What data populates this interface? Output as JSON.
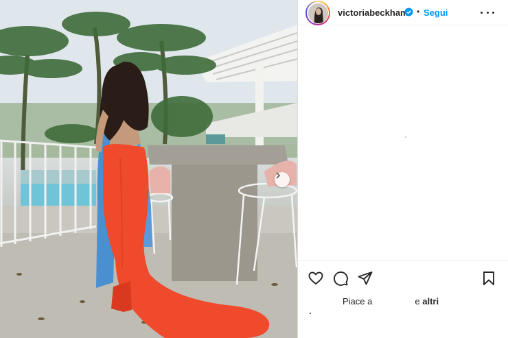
{
  "post": {
    "username": "victoriabeckham",
    "verified": true,
    "separator": "•",
    "follow_label": "Segui",
    "more_icon": "more-horizontal-icon"
  },
  "photo": {
    "next_icon": "chevron-right-icon"
  },
  "actions": {
    "icons": [
      "heart-icon",
      "comment-icon",
      "share-icon",
      "bookmark-icon"
    ]
  },
  "likes": {
    "prefix": "Piace a",
    "suffix_join": "e",
    "suffix_others": "altri"
  },
  "colors": {
    "accent": "#0095f6",
    "text": "#262626",
    "verified": "#0095f6",
    "dress": "#f04a2c",
    "wrap": "#4a8fd0"
  }
}
